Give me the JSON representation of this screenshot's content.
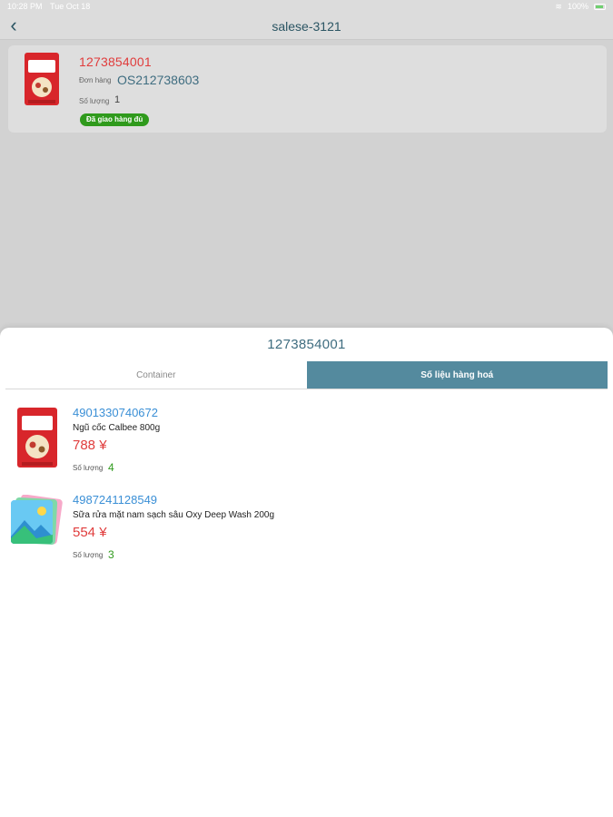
{
  "statusbar": {
    "time": "10:28 PM",
    "date": "Tue Oct 18",
    "battery": "100%"
  },
  "header": {
    "title": "salese-3121"
  },
  "order": {
    "id": "1273854001",
    "order_label": "Đơn hàng",
    "order_code": "OS212738603",
    "qty_label": "Số lượng",
    "qty": "1",
    "status": "Đã giao hàng đủ"
  },
  "sheet": {
    "title": "1273854001",
    "tabs": [
      {
        "label": "Container"
      },
      {
        "label": "Số liệu hàng hoá"
      }
    ],
    "items": [
      {
        "code": "4901330740672",
        "name": "Ngũ cốc Calbee 800g",
        "price": "788 ¥",
        "qty_label": "Số lượng",
        "qty": "4"
      },
      {
        "code": "4987241128549",
        "name": "Sữa rửa mặt nam sạch sâu Oxy Deep Wash 200g",
        "price": "554 ¥",
        "qty_label": "Số lượng",
        "qty": "3"
      }
    ]
  },
  "colors": {
    "accent": "#548a9e",
    "price": "#e03c3c",
    "code": "#3a8fd6",
    "status": "#2f9a1c"
  }
}
